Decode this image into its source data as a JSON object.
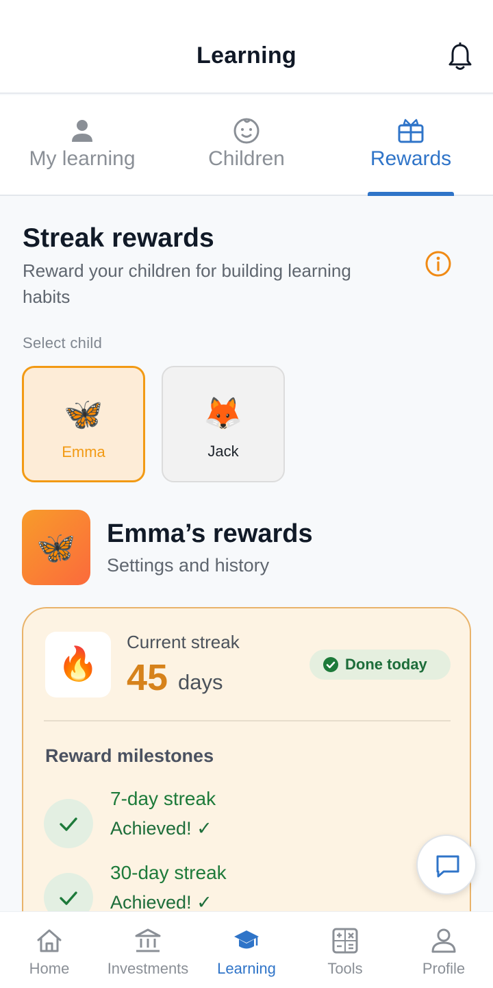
{
  "header": {
    "title": "Learning",
    "bell_icon": "bell-icon"
  },
  "tabs": [
    {
      "label": "My learning",
      "icon": "person-icon",
      "active": false
    },
    {
      "label": "Children",
      "icon": "baby-face-icon",
      "active": false
    },
    {
      "label": "Rewards",
      "icon": "gift-card-icon",
      "active": true
    }
  ],
  "streak_section": {
    "title": "Streak rewards",
    "subtitle": "Reward your children for building learning habits",
    "info_icon": "info-icon"
  },
  "select_child": {
    "label": "Select child",
    "children": [
      {
        "name": "Emma",
        "emoji": "🦋",
        "selected": true
      },
      {
        "name": "Jack",
        "emoji": "🦊",
        "selected": false
      }
    ]
  },
  "rewards_header": {
    "avatar_emoji": "🦋",
    "title": "Emma’s rewards",
    "subtitle": "Settings and history"
  },
  "streak_card": {
    "fire_emoji": "🔥",
    "label": "Current streak",
    "value": "45",
    "unit": "days",
    "status": "Done today",
    "milestones_heading": "Reward milestones",
    "milestones": [
      {
        "name": "7-day streak",
        "status": "Achieved! ✓"
      },
      {
        "name": "30-day streak",
        "status": "Achieved! ✓"
      }
    ]
  },
  "fab": {
    "icon": "chat-icon"
  },
  "bottom_nav": [
    {
      "label": "Home",
      "icon": "home-icon",
      "active": false
    },
    {
      "label": "Investments",
      "icon": "bank-icon",
      "active": false
    },
    {
      "label": "Learning",
      "icon": "graduation-cap-icon",
      "active": true
    },
    {
      "label": "Tools",
      "icon": "calculator-icon",
      "active": false
    },
    {
      "label": "Profile",
      "icon": "profile-icon",
      "active": false
    }
  ],
  "colors": {
    "accent": "#2f74c8",
    "orange": "#f29a14",
    "streak_orange": "#d6821b",
    "success_green": "#1d6d3a"
  }
}
